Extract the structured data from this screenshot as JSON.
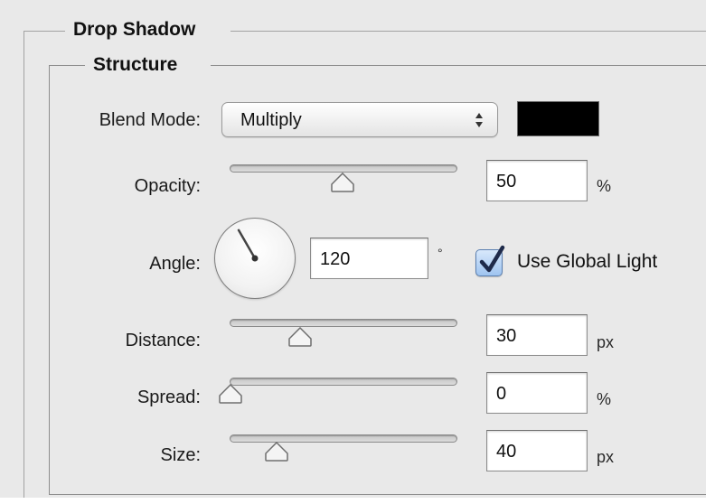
{
  "drop_shadow": {
    "legend": "Drop Shadow",
    "structure": {
      "legend": "Structure",
      "blend_mode": {
        "label": "Blend Mode:",
        "value": "Multiply",
        "color": "#000000"
      },
      "opacity": {
        "label": "Opacity:",
        "value": "50",
        "unit": "%",
        "slider_fraction": 0.5
      },
      "angle": {
        "label": "Angle:",
        "value": "120",
        "unit": "°",
        "degrees": 120
      },
      "use_global_light": {
        "label": "Use Global Light",
        "checked": true
      },
      "distance": {
        "label": "Distance:",
        "value": "30",
        "unit": "px",
        "slider_fraction": 0.3
      },
      "spread": {
        "label": "Spread:",
        "value": "0",
        "unit": "%",
        "slider_fraction": 0.0
      },
      "size": {
        "label": "Size:",
        "value": "40",
        "unit": "px",
        "slider_fraction": 0.18
      }
    }
  }
}
